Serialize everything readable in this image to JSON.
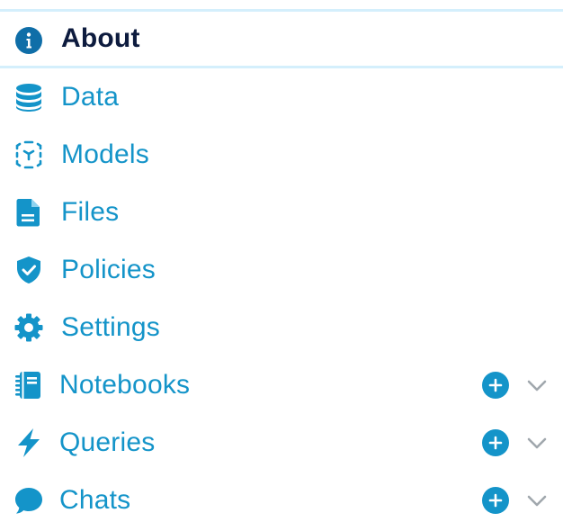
{
  "colors": {
    "accent": "#1494c9",
    "active_text": "#0d1b3e",
    "active_border": "#d4effc",
    "chevron": "#a0a7ad"
  },
  "nav": {
    "items": [
      {
        "label": "About",
        "icon": "info-icon",
        "active": true
      },
      {
        "label": "Data",
        "icon": "database-icon"
      },
      {
        "label": "Models",
        "icon": "model-cube-icon"
      },
      {
        "label": "Files",
        "icon": "file-icon"
      },
      {
        "label": "Policies",
        "icon": "shield-check-icon"
      },
      {
        "label": "Settings",
        "icon": "gear-icon"
      },
      {
        "label": "Notebooks",
        "icon": "notebook-icon",
        "expandable": true
      },
      {
        "label": "Queries",
        "icon": "lightning-icon",
        "expandable": true
      },
      {
        "label": "Chats",
        "icon": "chat-bubble-icon",
        "expandable": true
      }
    ]
  }
}
